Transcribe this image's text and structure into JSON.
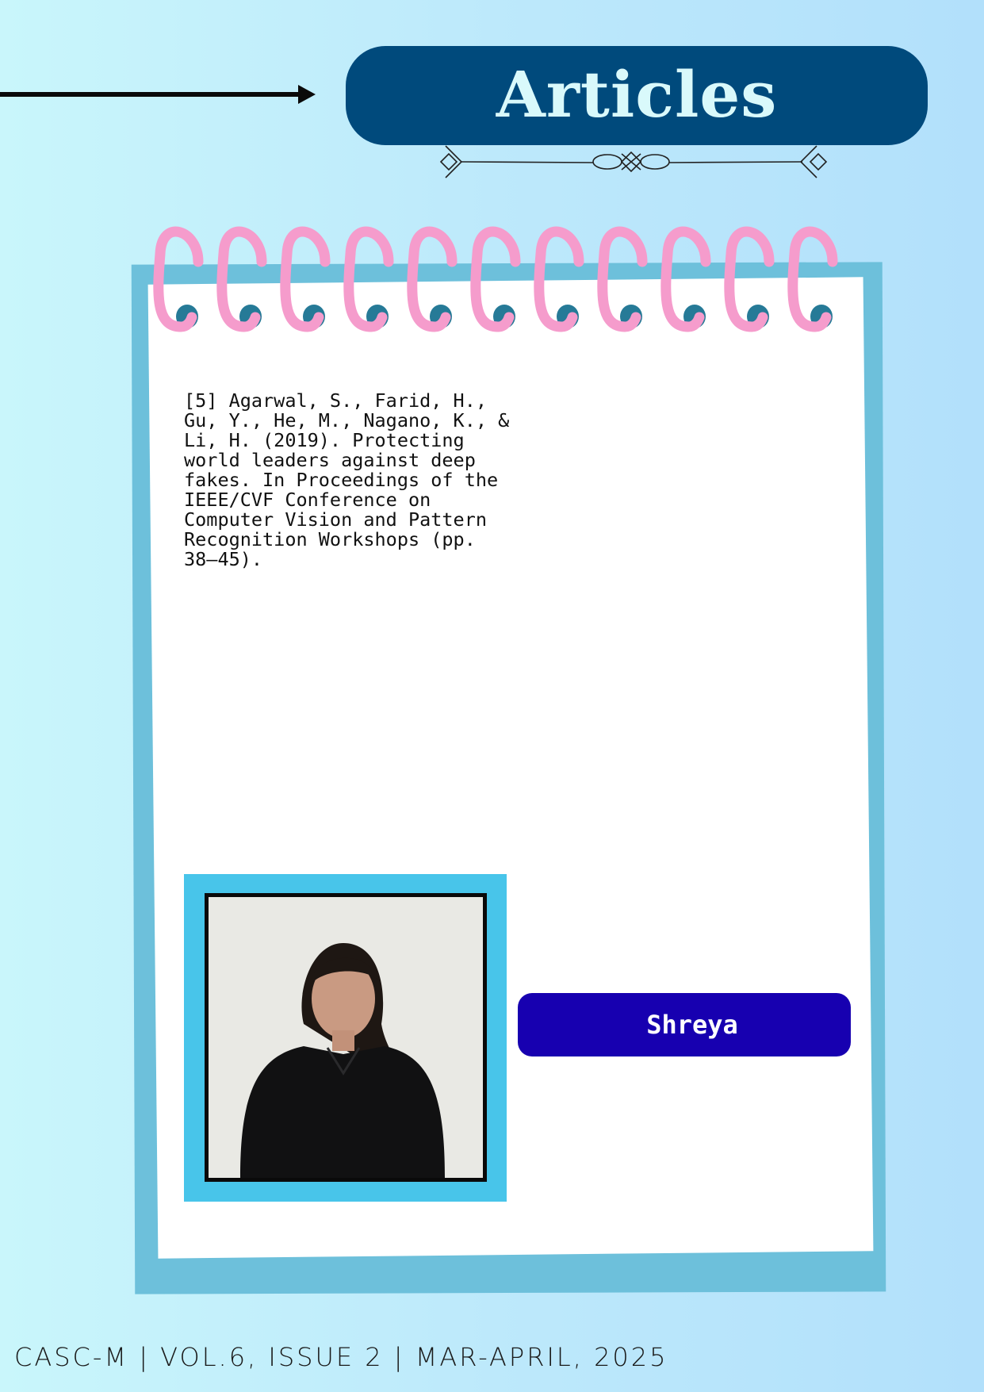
{
  "header": {
    "title": "Articles"
  },
  "article": {
    "reference": "[5] Agarwal, S., Farid, H.,\nGu, Y., He, M., Nagano, K., &\nLi, H. (2019). Protecting\nworld leaders against deep\nfakes. In Proceedings of the\nIEEE/CVF Conference on\nComputer Vision and Pattern\nRecognition Workshops (pp.\n38–45)."
  },
  "author": {
    "name": "Shreya"
  },
  "footer": {
    "text": "CASC-M | VOL.6, ISSUE 2 | MAR-APRIL, 2025"
  },
  "colors": {
    "title_bg": "#004a7c",
    "name_bg": "#1700b0",
    "ring": "#f59ccc",
    "hole": "#267a97",
    "board": "#6dc0db",
    "photo_border": "#48c5ea"
  }
}
